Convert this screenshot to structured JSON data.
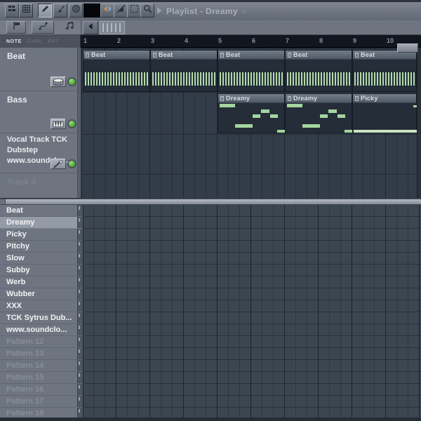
{
  "window": {
    "title": "Playlist - Dreamy",
    "detach_arrow": "»"
  },
  "toolbar": {
    "buttons": [
      {
        "icon": "blocks-icon"
      },
      {
        "icon": "grid-icon"
      },
      {
        "icon": "pencil-icon",
        "pressed": true
      },
      {
        "icon": "brush-icon"
      },
      {
        "icon": "delete-icon"
      },
      {
        "icon": "slip-icon"
      },
      {
        "icon": "mute-icon"
      },
      {
        "icon": "select-icon"
      },
      {
        "icon": "zoom-icon"
      }
    ]
  },
  "left_tabs": {
    "buttons": [
      {
        "icon": "marker-icon"
      },
      {
        "icon": "automation-icon"
      },
      {
        "icon": "music-note-icon"
      }
    ]
  },
  "scrollbar": {
    "back_icon": "left-arrow-icon"
  },
  "mini_labels": {
    "l1": "NOTE",
    "l2": "CHNL",
    "l3": "PAT"
  },
  "ruler": {
    "numbers": [
      "1",
      "2",
      "3",
      "4",
      "5",
      "6",
      "7",
      "8",
      "9",
      "10"
    ]
  },
  "tracks": [
    {
      "name": "Beat",
      "icon": "drum-icon",
      "clips": [
        {
          "label": "Beat"
        },
        {
          "label": "Beat"
        },
        {
          "label": "Beat"
        },
        {
          "label": "Beat"
        },
        {
          "label": "Beat"
        }
      ]
    },
    {
      "name": "Bass",
      "icon": "piano-icon",
      "clips": [
        {
          "label": "Dreamy"
        },
        {
          "label": "Dreamy"
        },
        {
          "label": "Picky"
        }
      ]
    },
    {
      "name": "Vocal Track TCK Dubstep www.soundclou...",
      "icon": "wrench-icon",
      "lines": [
        "Vocal Track TCK",
        "Dubstep",
        "www.soundclou..."
      ]
    },
    {
      "name": "Track 4",
      "disabled": true
    }
  ],
  "pattern_list": {
    "items": [
      {
        "label": "Beat"
      },
      {
        "label": "Dreamy",
        "selected": true
      },
      {
        "label": "Picky"
      },
      {
        "label": "Pitchy"
      },
      {
        "label": "Slow"
      },
      {
        "label": "Subby"
      },
      {
        "label": "Werb"
      },
      {
        "label": "Wubber"
      },
      {
        "label": "XXX"
      },
      {
        "label": "TCK Sytrus Dub..."
      },
      {
        "label": "www.soundclo..."
      },
      {
        "label": "Pattern 12",
        "disabled": true
      },
      {
        "label": "Pattern 13",
        "disabled": true
      },
      {
        "label": "Pattern 14",
        "disabled": true
      },
      {
        "label": "Pattern 15",
        "disabled": true
      },
      {
        "label": "Pattern 16",
        "disabled": true
      },
      {
        "label": "Pattern 17",
        "disabled": true
      },
      {
        "label": "Pattern 18",
        "disabled": true
      }
    ]
  },
  "colors": {
    "note_green": "#a5d59e",
    "beat_stripe_green": "#b3daab",
    "led_green": "#42a528",
    "selected_row": "#949ba7",
    "grid_top": "#333d49",
    "grid_bottom": "#3b4651",
    "ruler_bg": "#11161f"
  }
}
